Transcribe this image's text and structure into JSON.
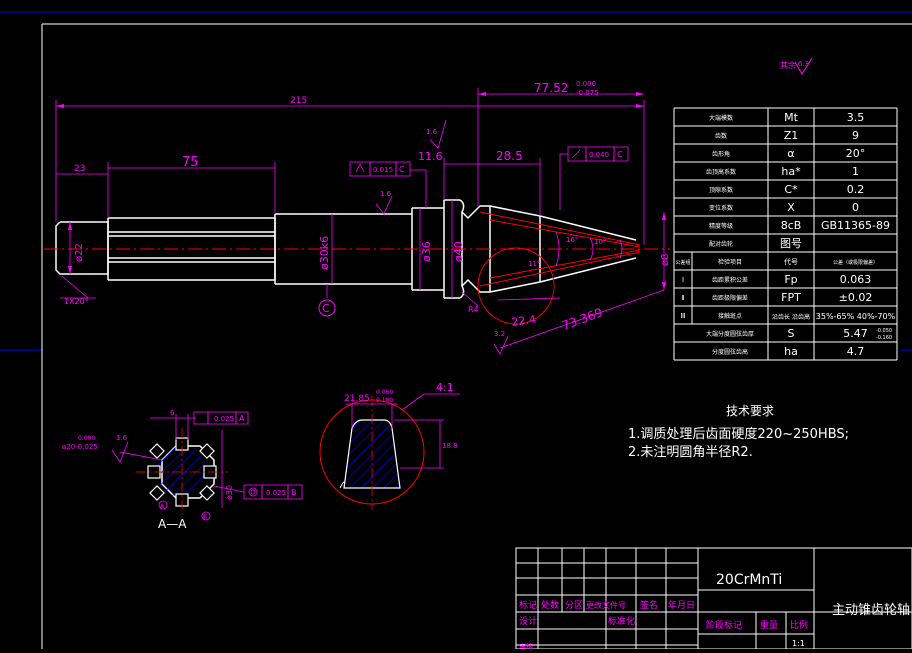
{
  "colors": {
    "background": "#000000",
    "outline": "#ffffff",
    "dimension": "#ff00ff",
    "centerline": "#ff0000",
    "hatch": "#0000ff",
    "border": "#0000ff",
    "text": "#ffffff"
  },
  "dims": {
    "overall_length": "215",
    "length_23": "23",
    "length_75": "75",
    "length_77": "77.52",
    "tol_77_upper": "0.000",
    "tol_77_lower": "-0.075",
    "length_11": "11.6",
    "length_28": "28.5",
    "dia_22": "ø22",
    "dia_30": "ø30k6",
    "dia_36": "ø36",
    "dia_40": "ø40",
    "dia_8": "ø8",
    "chamfer": "1X20°",
    "radius": "R4",
    "slant_22": "22.4",
    "slant_73": "73.369",
    "angle_16": "16°",
    "angle_10": "10°",
    "angle_11": "11°",
    "datum_c": "C",
    "rough_top": "1.6",
    "rough_mid": "1.6",
    "rough_corner": "3.2"
  },
  "tolerance_frames": {
    "tf1_val": "0.015",
    "tf1_ref": "C",
    "tf2_val": "0.040",
    "tf2_ref": "C",
    "tf3_val": "0.025",
    "tf3_ref": "A",
    "tf4_val": "0.025",
    "tf4_ref": "B"
  },
  "section": {
    "label": "A—A",
    "dim_6": "6",
    "dim_20": "ø20-0.025",
    "dim_20_upper": "0.000",
    "dim_32": "ø30",
    "rough": "1.6",
    "mark_a": "A",
    "mark_b": "B"
  },
  "tooth": {
    "width": "21.85",
    "width_upper": "0.060",
    "width_lower": "0.180",
    "ratio": "4:1",
    "height": "18.8"
  },
  "param_table": {
    "rows": [
      {
        "name": "大端模数",
        "sym": "Mt",
        "val": "3.5"
      },
      {
        "name": "齿数",
        "sym": "Z1",
        "val": "9"
      },
      {
        "name": "齿形角",
        "sym": "α",
        "val": "20°"
      },
      {
        "name": "齿顶高系数",
        "sym": "ha*",
        "val": "1"
      },
      {
        "name": "顶隙系数",
        "sym": "C*",
        "val": "0.2"
      },
      {
        "name": "变位系数",
        "sym": "X",
        "val": "0"
      },
      {
        "name": "精度等级",
        "sym": "8cB",
        "val": "GB11365-89"
      },
      {
        "name": "配对齿轮",
        "sym": "图号",
        "val": ""
      }
    ],
    "sub_header": {
      "c1": "公差组",
      "c2": "检验项目",
      "c3": "代号",
      "c4": "公差（或极限偏差）"
    },
    "tol_rows": [
      {
        "grp": "Ⅰ",
        "item": "齿距累积公差",
        "sym": "Fp",
        "val": "0.063"
      },
      {
        "grp": "Ⅱ",
        "item": "齿距极限偏差",
        "sym": "FPT",
        "val": "±0.02"
      },
      {
        "grp": "Ⅲ",
        "item": "接触斑点",
        "sym": "沿齿长 沿齿高",
        "val": "35%-65% 40%-70%"
      },
      {
        "grp": "",
        "item": "大端分度圆弦齿厚",
        "sym": "S",
        "val": "5.47"
      },
      {
        "grp": "",
        "item": "分度圆弦齿高",
        "sym": "ha",
        "val": "4.7"
      }
    ],
    "s_upper": "-0.050",
    "s_lower": "-0.160"
  },
  "tech": {
    "title": "技术要求",
    "line1": "1.调质处理后齿面硬度220~250HBS;",
    "line2": "2.未注明圆角半径R2."
  },
  "rough_note": {
    "text": "其余",
    "value": "6.3"
  },
  "title_block": {
    "material": "20CrMnTi",
    "part_name": "主动锥齿轮轴",
    "h_mark": "标记",
    "h_count": "处数",
    "h_zone": "分区",
    "h_doc": "更改文件号",
    "h_sign": "签名",
    "h_date": "年月日",
    "h_design": "设计",
    "h_std": "标准化",
    "h_stage": "阶段标记",
    "h_weight": "重量",
    "h_scale": "比例",
    "scale": "1:1",
    "h_check": "审核"
  }
}
